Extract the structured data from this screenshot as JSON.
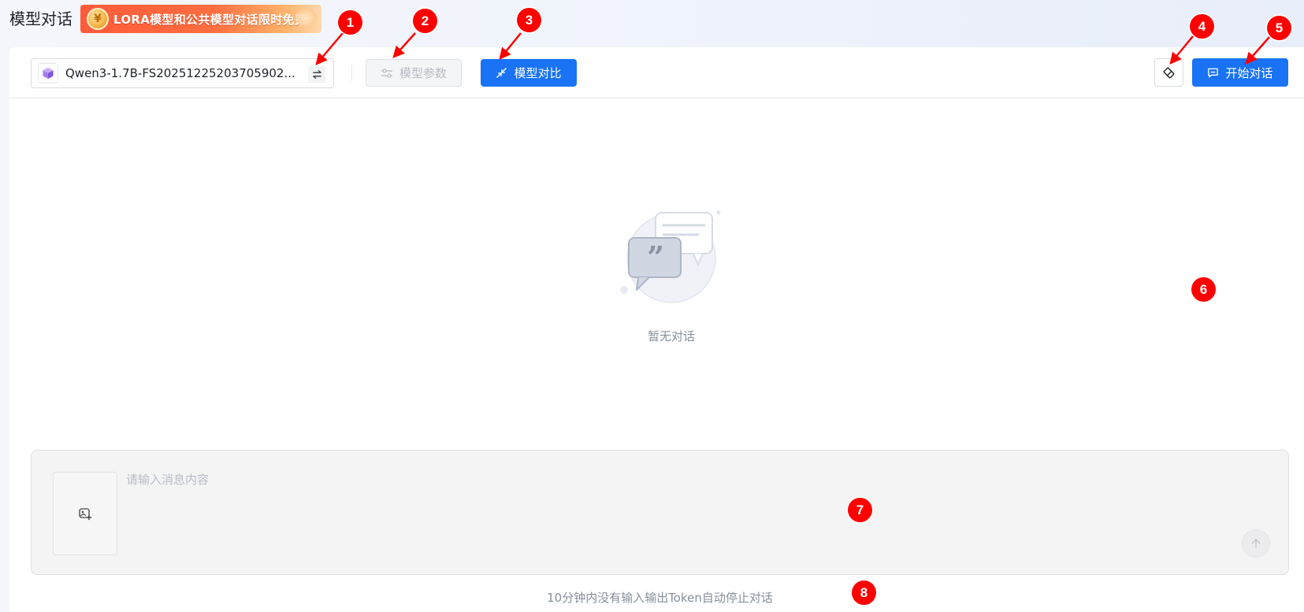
{
  "header": {
    "title": "模型对话",
    "promo": {
      "coin_symbol": "¥",
      "text": "LORA模型和公共模型对话限时免费"
    }
  },
  "toolbar": {
    "model_name": "Qwen3-1.7B-FS20251225203705902...",
    "params_label": "模型参数",
    "compare_label": "模型对比",
    "start_label": "开始对话"
  },
  "empty_state": {
    "text": "暂无对话"
  },
  "input": {
    "placeholder": "请输入消息内容",
    "value": ""
  },
  "footer": {
    "hint": "10分钟内没有输入输出Token自动停止对话"
  },
  "markers": [
    "1",
    "2",
    "3",
    "4",
    "5",
    "6",
    "7",
    "8"
  ],
  "colors": {
    "primary": "#1a73f5",
    "marker": "#ff0000",
    "promo_start": "#ff5b3b",
    "muted_text": "#86909c"
  },
  "icons": {
    "model_logo": "purple-cube-icon",
    "switch": "swap-arrows-icon",
    "params": "sliders-icon",
    "compare": "compare-arrows-icon",
    "clear": "eraser-icon",
    "start": "chat-bubble-icon",
    "upload": "image-add-icon",
    "send": "arrow-up-icon"
  }
}
